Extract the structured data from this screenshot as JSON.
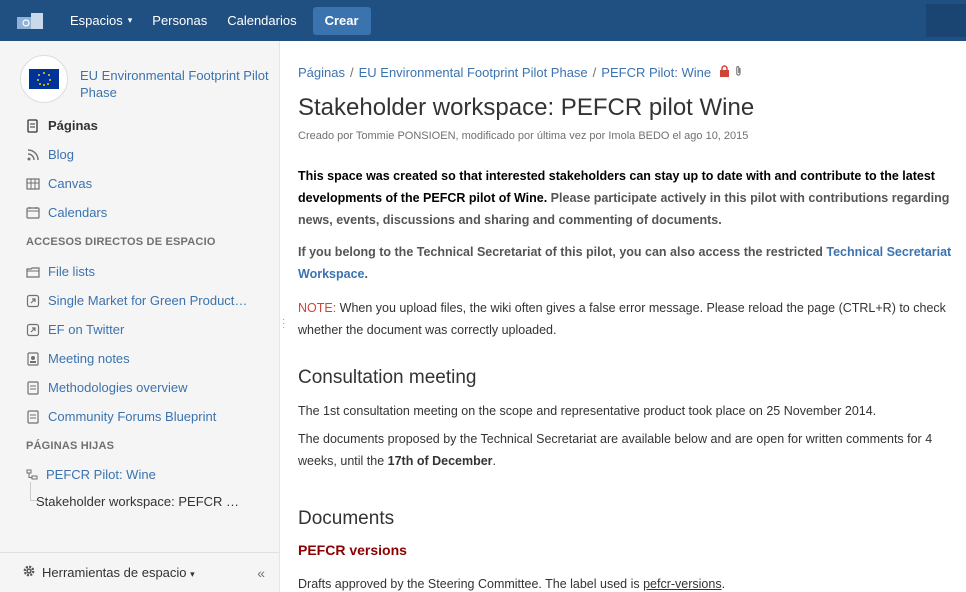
{
  "topbar": {
    "nav": [
      {
        "label": "Espacios",
        "caret": "▾"
      },
      {
        "label": "Personas"
      },
      {
        "label": "Calendarios"
      }
    ],
    "create_label": "Crear"
  },
  "sidebar": {
    "space_name": "EU Environmental Footprint Pilot Phase",
    "items": [
      {
        "label": "Páginas",
        "icon": "pages-icon"
      },
      {
        "label": "Blog",
        "icon": "blog-icon"
      },
      {
        "label": "Canvas",
        "icon": "canvas-icon"
      },
      {
        "label": "Calendars",
        "icon": "calendar-icon"
      }
    ],
    "shortcuts_heading": "ACCESOS DIRECTOS DE ESPACIO",
    "shortcuts": [
      {
        "label": "File lists",
        "icon": "file-list-icon"
      },
      {
        "label": "Single Market for Green Product…",
        "icon": "external-link-icon"
      },
      {
        "label": "EF on Twitter",
        "icon": "external-link-icon"
      },
      {
        "label": "Meeting notes",
        "icon": "meeting-notes-icon"
      },
      {
        "label": "Methodologies overview",
        "icon": "document-icon"
      },
      {
        "label": "Community Forums Blueprint",
        "icon": "document-icon"
      }
    ],
    "children_heading": "PÁGINAS HIJAS",
    "children": [
      {
        "label": "PEFCR Pilot: Wine"
      },
      {
        "label": "Stakeholder workspace: PEFCR …"
      }
    ],
    "tools_label": "Herramientas de espacio",
    "tools_caret": "▾",
    "collapse_label": "«"
  },
  "main": {
    "breadcrumb": [
      "Páginas",
      "EU Environmental Footprint Pilot Phase",
      "PEFCR Pilot: Wine"
    ],
    "breadcrumb_sep": "/",
    "title": "Stakeholder workspace: PEFCR pilot Wine",
    "meta": "Creado por Tommie PONSIOEN, modificado por última vez por Imola BEDO el ago 10, 2015",
    "p1_bold": "This space was created so that interested stakeholders can stay up to date with and contribute to the latest developments of the PEFCR pilot of Wine.",
    "p1_rest": " Please participate actively in this pilot with contributions regarding news, events, discussions and sharing and commenting of documents.",
    "p2_text": "If you belong to the Technical Secretariat of this pilot, you can also access the restricted ",
    "p2_link": "Technical Secretariat Workspace",
    "p2_end": ".",
    "p3_note": "NOTE:",
    "p3_text": " When you upload files, the wiki often gives a false error message. Please reload the page (CTRL+R) to check whether the document was correctly uploaded.",
    "h_consultation": "Consultation meeting",
    "p4": "The 1st consultation meeting on the scope and representative product took place on 25 November 2014.",
    "p5_text": "The documents proposed by the Technical Secretariat are available below and are open for written comments for 4 weeks, until the ",
    "p5_bold": "17th of December",
    "p5_end": ".",
    "h_documents": "Documents",
    "h_versions": "PEFCR versions",
    "p6_text": "Drafts approved by the Steering Committee. The label used is ",
    "p6_label": "pefcr-versions",
    "p6_end": "."
  },
  "colors": {
    "nav_bg": "#205081",
    "link": "#3b73af",
    "note": "#d04437",
    "subheading": "#8b0000"
  }
}
